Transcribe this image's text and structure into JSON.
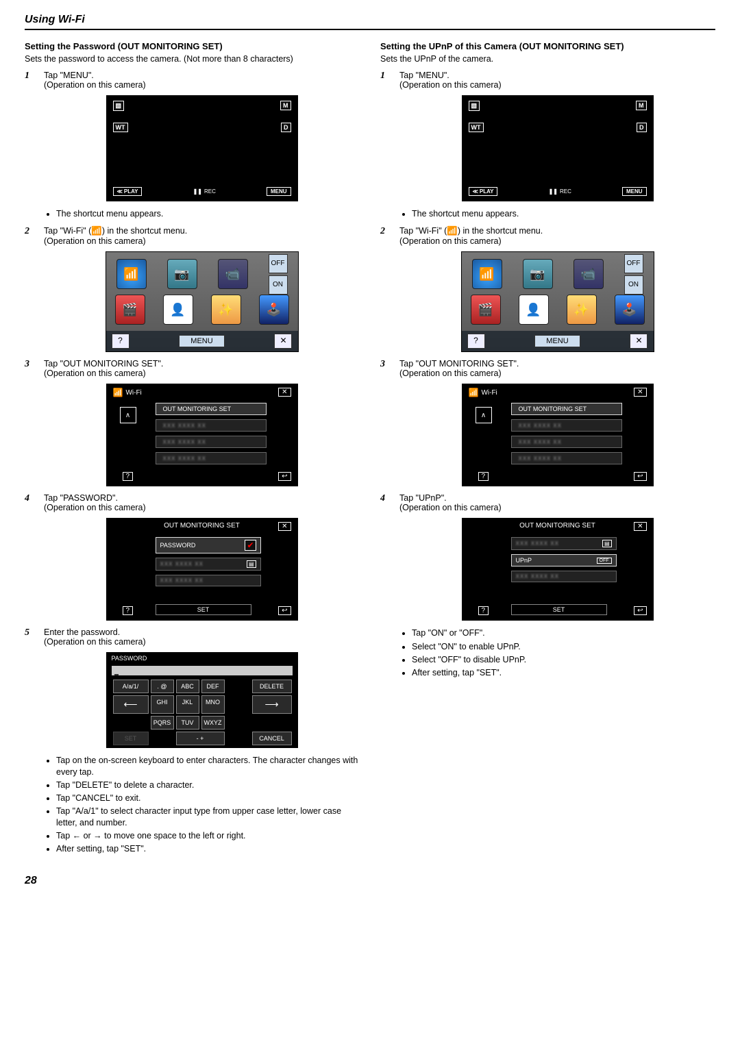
{
  "header": {
    "title": "Using Wi-Fi"
  },
  "left": {
    "heading": "Setting the Password (OUT MONITORING SET)",
    "intro": "Sets the password to access the camera. (Not more than 8 characters)",
    "menu_screen": {
      "play": "PLAY",
      "rec": "REC",
      "menu": "MENU",
      "wt": "WT",
      "m": "M",
      "d": "D"
    },
    "shortcut_screen": {
      "menu_btn": "MENU",
      "help": "?",
      "close": "✕"
    },
    "wifi_screen": {
      "title": "Wi-Fi",
      "item": "OUT MONITORING SET",
      "help": "?",
      "close": "✕",
      "back": "↩"
    },
    "pwd_screen": {
      "title": "OUT MONITORING SET",
      "item_pwd": "PASSWORD",
      "set": "SET",
      "help": "?",
      "close": "✕",
      "back": "↩"
    },
    "keyboard": {
      "title": "PASSWORD",
      "keys": {
        "mode": "A/a/1/",
        "dot": ".  @",
        "abc": "ABC",
        "def": "DEF",
        "delete": "DELETE",
        "left": "←",
        "ghi": "GHI",
        "jkl": "JKL",
        "mno": "MNO",
        "right": "→",
        "pqrs": "PQRS",
        "tuv": "TUV",
        "wxyz": "WXYZ",
        "set": "SET",
        "sym": "-  +",
        "cancel": "CANCEL"
      }
    },
    "steps": [
      {
        "line1": "Tap \"MENU\".",
        "line2": "(Operation on this camera)",
        "bullets": [
          "The shortcut menu appears."
        ]
      },
      {
        "line1": "Tap \"Wi-Fi\" (📶) in the shortcut menu.",
        "line2": "(Operation on this camera)"
      },
      {
        "line1": "Tap \"OUT MONITORING SET\".",
        "line2": "(Operation on this camera)"
      },
      {
        "line1": "Tap \"PASSWORD\".",
        "line2": "(Operation on this camera)"
      },
      {
        "line1": "Enter the password.",
        "line2": "(Operation on this camera)",
        "bullets": [
          "Tap on the on-screen keyboard to enter characters. The character changes with every tap.",
          "Tap \"DELETE\" to delete a character.",
          "Tap \"CANCEL\" to exit.",
          "Tap \"A/a/1\" to select character input type from upper case letter, lower case letter, and number.",
          "Tap ← or → to move one space to the left or right.",
          "After setting, tap \"SET\"."
        ]
      }
    ]
  },
  "right": {
    "heading": "Setting the UPnP of this Camera (OUT MONITORING SET)",
    "intro": "Sets the UPnP of the camera.",
    "menu_screen": {
      "play": "PLAY",
      "rec": "REC",
      "menu": "MENU",
      "wt": "WT",
      "m": "M",
      "d": "D"
    },
    "shortcut_screen": {
      "menu_btn": "MENU",
      "help": "?",
      "close": "✕"
    },
    "wifi_screen": {
      "title": "Wi-Fi",
      "item": "OUT MONITORING SET",
      "help": "?",
      "close": "✕",
      "back": "↩"
    },
    "upnp_screen": {
      "title": "OUT MONITORING SET",
      "item_upnp": "UPnP",
      "off": "OFF",
      "set": "SET",
      "help": "?",
      "close": "✕",
      "back": "↩"
    },
    "steps": [
      {
        "line1": "Tap \"MENU\".",
        "line2": "(Operation on this camera)",
        "bullets": [
          "The shortcut menu appears."
        ]
      },
      {
        "line1": "Tap \"Wi-Fi\" (📶) in the shortcut menu.",
        "line2": "(Operation on this camera)"
      },
      {
        "line1": "Tap \"OUT MONITORING SET\".",
        "line2": "(Operation on this camera)"
      },
      {
        "line1": "Tap \"UPnP\".",
        "line2": "(Operation on this camera)",
        "bullets": [
          "Tap \"ON\" or \"OFF\".",
          "Select \"ON\" to enable UPnP.",
          "Select \"OFF\" to disable UPnP.",
          "After setting, tap \"SET\"."
        ]
      }
    ]
  },
  "pageNumber": "28"
}
